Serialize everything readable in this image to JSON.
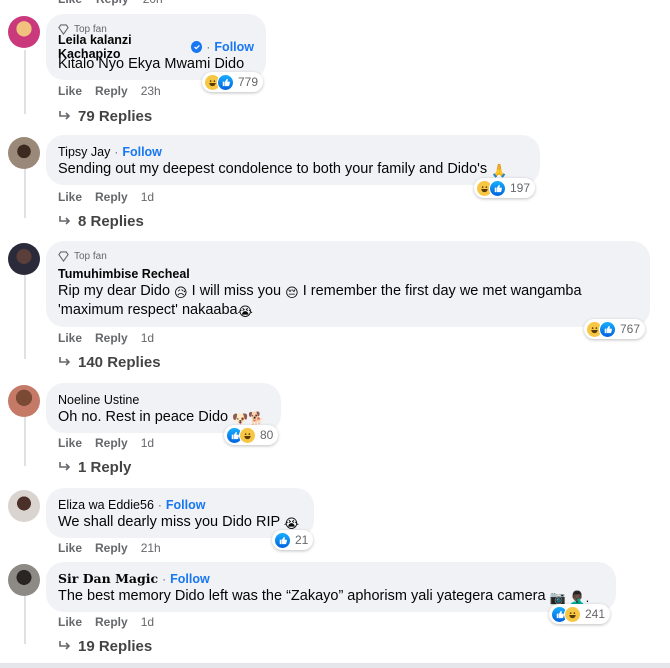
{
  "top_partial": {
    "like": "Like",
    "reply": "Reply",
    "time": "20h"
  },
  "common": {
    "like": "Like",
    "reply": "Reply",
    "follow": "Follow",
    "top_fan": "Top fan"
  },
  "comments": [
    {
      "author": "Leila kalanzi Kachapizo",
      "verified": true,
      "top_fan": true,
      "text": "Kitalo Nyo Ekya Mwami Dido",
      "reactions": {
        "icons": [
          "haha",
          "like"
        ],
        "count": "779"
      },
      "time": "23h",
      "replies": "79 Replies",
      "avatar_color": "#c9397c"
    },
    {
      "author": "Tipsy Jay",
      "text": "Sending out my deepest condolence to both your family and Dido's",
      "text_emoji": "🙏",
      "reactions": {
        "icons": [
          "haha",
          "like"
        ],
        "count": "197"
      },
      "time": "1d",
      "replies": "8 Replies",
      "avatar_color": "#6b5a4a"
    },
    {
      "author": "Tumuhimbise Recheal",
      "top_fan": true,
      "text_line1_a": "Rip my dear Dido",
      "text_line1_e1": "😥",
      "text_line1_b": "I will miss you",
      "text_line1_e2": "😔",
      "text_line1_c": "I remember the first day we met wangamba",
      "text_line2": "'maximum respect' nakaaba",
      "text_line2_emoji": "😭",
      "reactions": {
        "icons": [
          "haha",
          "like"
        ],
        "count": "767"
      },
      "time": "1d",
      "replies": "140 Replies",
      "avatar_color": "#3d2b3a"
    },
    {
      "author": "Noeline Ustine",
      "text": "Oh no. Rest in peace Dido",
      "text_emoji": "🐶🐕",
      "reactions": {
        "icons": [
          "like",
          "haha"
        ],
        "count": "80"
      },
      "time": "1d",
      "replies": "1 Reply",
      "avatar_color": "#8a4b3c"
    },
    {
      "author": "Eliza wa Eddie56",
      "text": "We shall dearly miss you Dido RIP",
      "text_emoji": "😭",
      "reactions": {
        "icons": [
          "like"
        ],
        "count": "21"
      },
      "time": "21h",
      "avatar_color": "#2e2522"
    },
    {
      "author": "Sir Dan Magic",
      "text": "The best memory Dido left was the “Zakayo” aphorism yali yategera camera",
      "text_emoji": "📷 🤦🏿‍♂️.",
      "reactions": {
        "icons": [
          "like",
          "haha"
        ],
        "count": "241"
      },
      "time": "1d",
      "replies": "19 Replies",
      "avatar_color": "#3a3633"
    }
  ]
}
